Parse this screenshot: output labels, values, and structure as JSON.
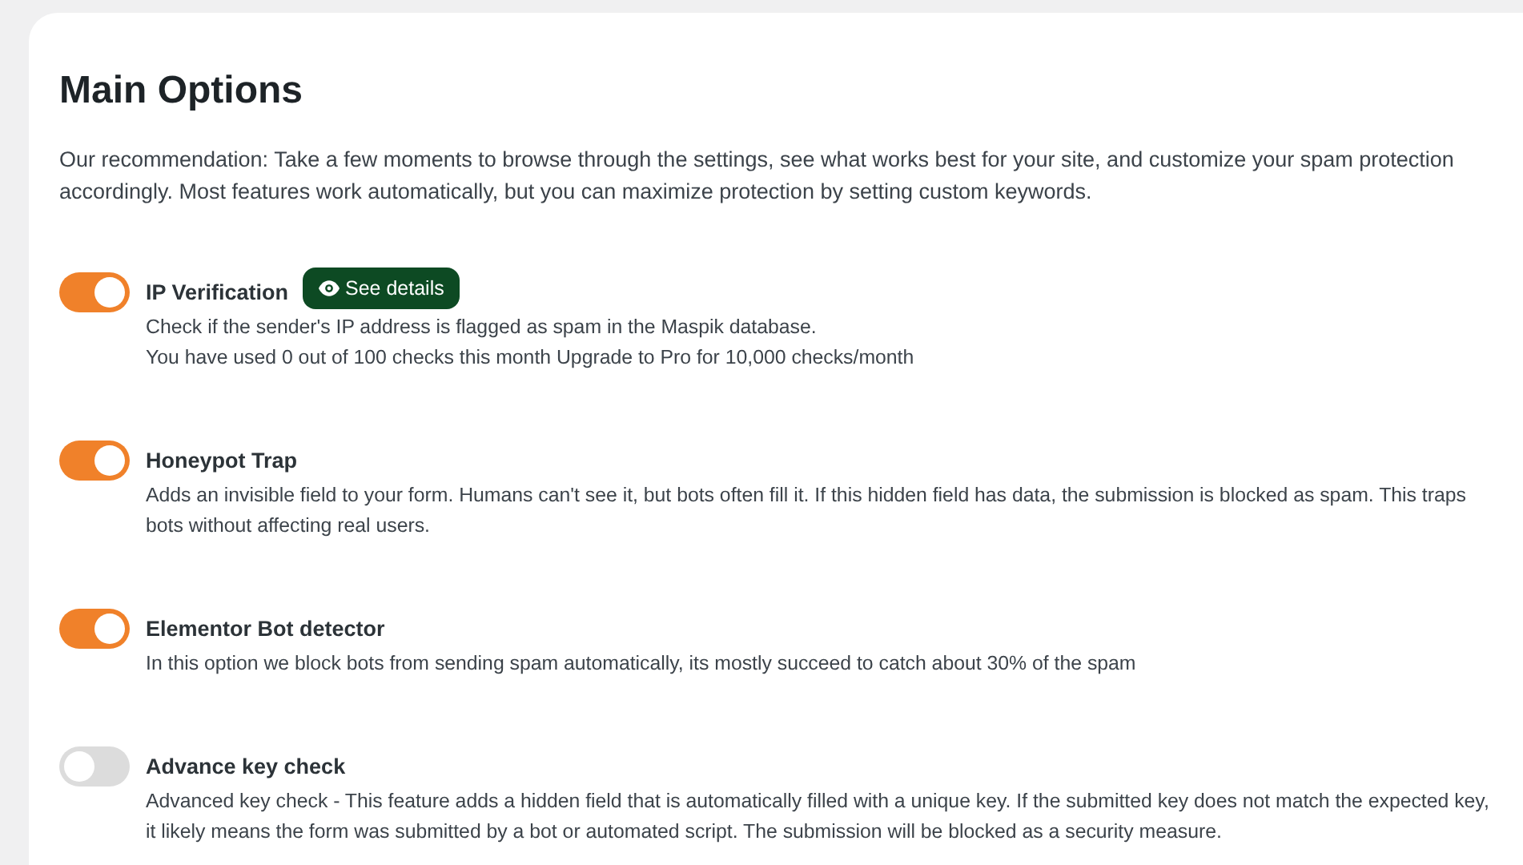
{
  "title": "Main Options",
  "intro": "Our recommendation: Take a few moments to browse through the settings, see what works best for your site, and customize your spam protection accordingly. Most features work automatically, but you can maximize protection by setting custom keywords.",
  "options": [
    {
      "label": "IP Verification",
      "on": true,
      "details_button": "See details",
      "description": [
        "Check if the sender's IP address is flagged as spam in the Maspik database.",
        "You have used 0 out of 100 checks this month Upgrade to Pro for 10,000 checks/month"
      ]
    },
    {
      "label": "Honeypot Trap",
      "on": true,
      "description": [
        "Adds an invisible field to your form. Humans can't see it, but bots often fill it. If this hidden field has data, the submission is blocked as spam. This traps bots without affecting real users."
      ]
    },
    {
      "label": "Elementor Bot detector",
      "on": true,
      "description": [
        "In this option we block bots from sending spam automatically, its mostly succeed to catch about 30% of the spam"
      ]
    },
    {
      "label": "Advance key check",
      "on": false,
      "description": [
        "Advanced key check - This feature adds a hidden field that is automatically filled with a unique key. If the submitted key does not match the expected key, it likely means the form was submitted by a bot or automated script. The submission will be blocked as a security measure."
      ]
    }
  ]
}
